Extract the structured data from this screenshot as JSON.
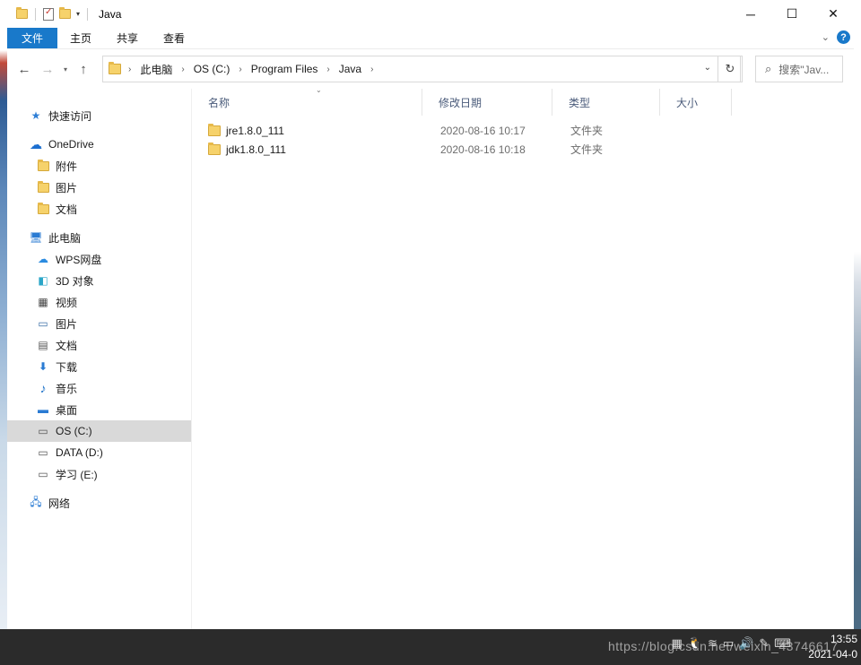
{
  "window": {
    "title": "Java",
    "controls": {
      "minimize": "─",
      "maximize": "☐",
      "close": "✕"
    }
  },
  "ribbon": {
    "tabs": [
      "文件",
      "主页",
      "共享",
      "查看"
    ],
    "help": "?"
  },
  "address": {
    "crumbs": [
      "此电脑",
      "OS (C:)",
      "Program Files",
      "Java"
    ],
    "search_placeholder": "搜索\"Jav..."
  },
  "sidebar": {
    "quick_access": "快速访问",
    "onedrive": "OneDrive",
    "onedrive_items": [
      "附件",
      "图片",
      "文档"
    ],
    "this_pc": "此电脑",
    "pc_items": [
      "WPS网盘",
      "3D 对象",
      "视频",
      "图片",
      "文档",
      "下载",
      "音乐",
      "桌面",
      "OS (C:)",
      "DATA (D:)",
      "学习 (E:)"
    ],
    "network": "网络"
  },
  "columns": [
    "名称",
    "修改日期",
    "类型",
    "大小"
  ],
  "files": [
    {
      "name": "jre1.8.0_111",
      "modified": "2020-08-16 10:17",
      "type": "文件夹",
      "size": ""
    },
    {
      "name": "jdk1.8.0_111",
      "modified": "2020-08-16 10:18",
      "type": "文件夹",
      "size": ""
    }
  ],
  "taskbar": {
    "time": "13:55",
    "date": "2021-04-0",
    "watermark": "https://blog.csdn.net/weixin_43746617"
  },
  "colors": {
    "accent": "#1979ca",
    "folder": "#f6d26b",
    "selected": "#d9d9d9"
  }
}
